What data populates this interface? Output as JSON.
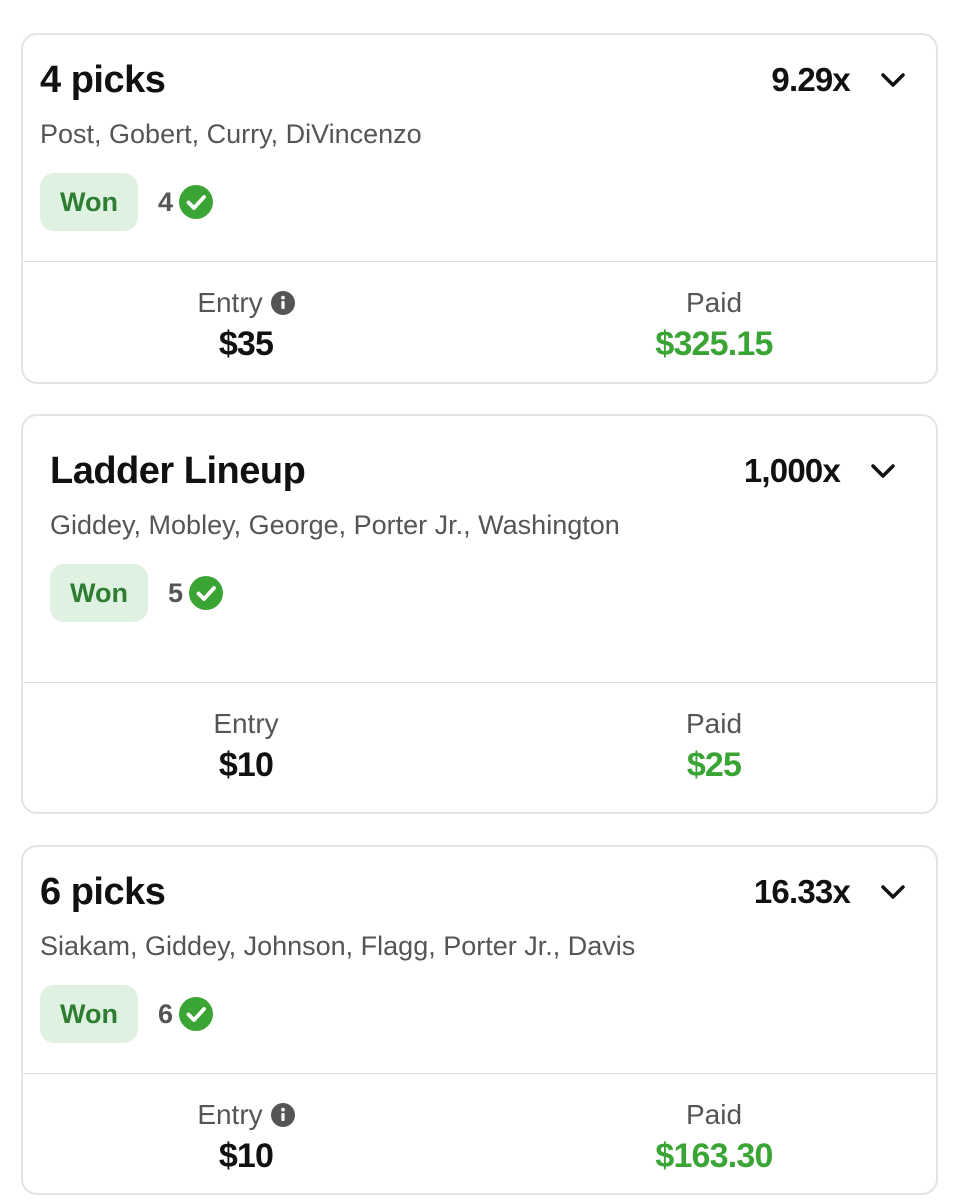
{
  "colors": {
    "won_text": "#2e7d32",
    "won_bg": "#dff2e2",
    "check": "#3aa534",
    "paid": "#3aa534",
    "info_icon": "#555555"
  },
  "icons": {
    "expand": "chevron-down-icon",
    "check": "check-circle-icon",
    "info": "info-icon"
  },
  "entries": [
    {
      "title": "4 picks",
      "multiplier": "9.29x",
      "players": "Post, Gobert, Curry, DiVincenzo",
      "status": "Won",
      "correct_count": "4",
      "entry_label": "Entry",
      "entry_value": "$35",
      "paid_label": "Paid",
      "paid_value": "$325.15"
    },
    {
      "title": "Ladder Lineup",
      "multiplier": "1,000x",
      "players": "Giddey, Mobley, George, Porter Jr., Washington",
      "status": "Won",
      "correct_count": "5",
      "entry_label": "Entry",
      "entry_value": "$10",
      "paid_label": "Paid",
      "paid_value": "$25"
    },
    {
      "title": "6 picks",
      "multiplier": "16.33x",
      "players": "Siakam, Giddey, Johnson, Flagg, Porter Jr., Davis",
      "status": "Won",
      "correct_count": "6",
      "entry_label": "Entry",
      "entry_value": "$10",
      "paid_label": "Paid",
      "paid_value": "$163.30"
    }
  ]
}
